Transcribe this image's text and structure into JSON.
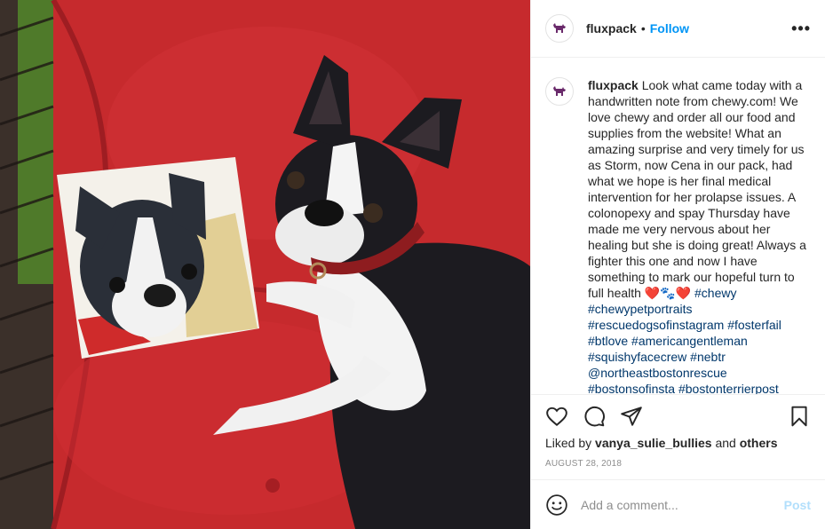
{
  "header": {
    "username": "fluxpack",
    "dot": "•",
    "follow_label": "Follow",
    "more_label": "•••"
  },
  "caption": {
    "username": "fluxpack",
    "text": "Look what came today with a handwritten note from chewy.com! We love chewy and order all our food and supplies from the website! What an amazing surprise and very timely for us as Storm, now Cena in our pack, had what we hope is her final medical intervention for her prolapse issues. A colonopexy and spay Thursday have made me very nervous about her healing but she is doing great! Always a fighter this one and now I have something to mark our hopeful turn to full health ❤️🐾❤️",
    "tags": [
      "#chewy",
      "#chewypetportraits",
      "#rescuedogsofinstagram",
      "#fosterfail",
      "#btlove",
      "#americangentleman",
      "#squishyfacecrew",
      "#nebtr",
      "@northeastbostonrescue",
      "#bostonsofinsta",
      "#bostonterrierpost"
    ]
  },
  "likes": {
    "prefix": "Liked by",
    "user": "vanya_sulie_bullies",
    "conj": "and",
    "others": "others"
  },
  "date": "AUGUST 28, 2018",
  "comment": {
    "placeholder": "Add a comment...",
    "post_label": "Post"
  },
  "colors": {
    "follow": "#0095f6",
    "hashtag": "#00376b",
    "post_disabled": "#b2dffc",
    "cushion": "#c8262b"
  },
  "icons": {
    "like": "heart-icon",
    "comment": "comment-icon",
    "share": "paper-plane-icon",
    "save": "bookmark-icon",
    "emoji": "emoji-icon",
    "avatar": "dog-logo-icon"
  }
}
